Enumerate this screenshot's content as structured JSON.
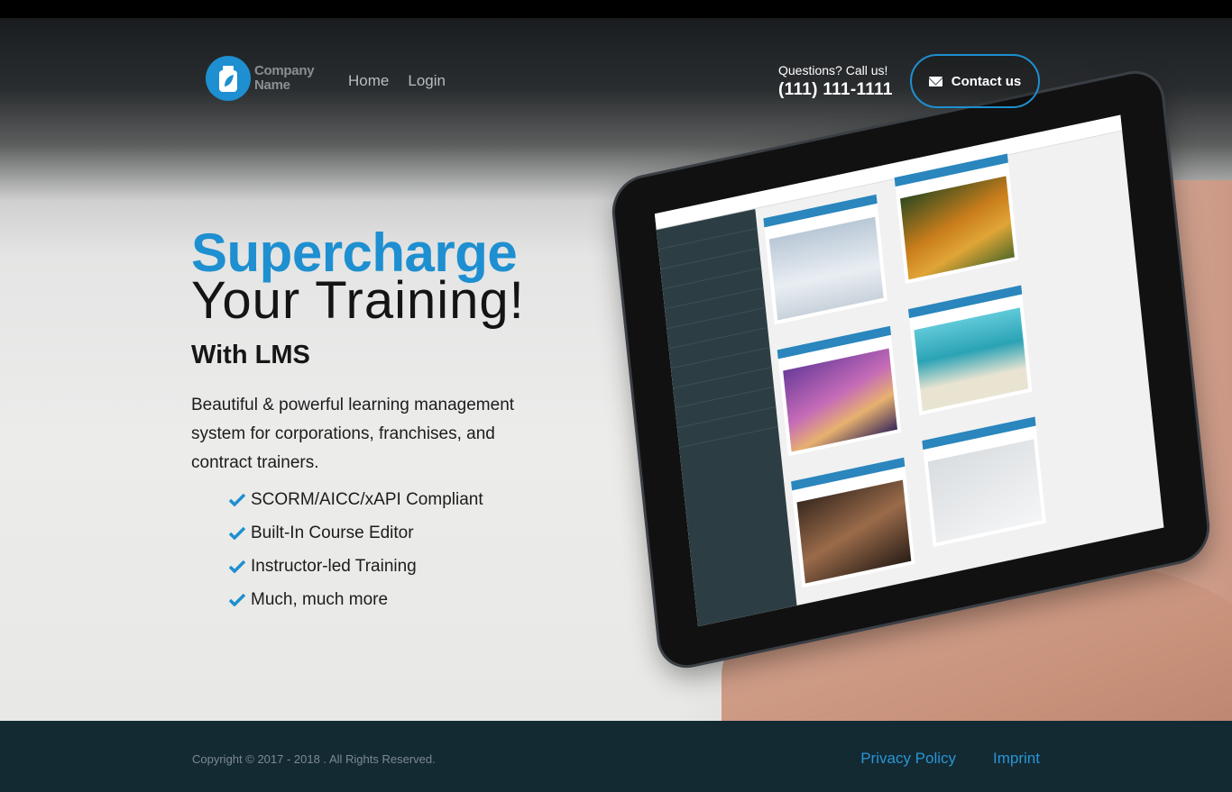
{
  "header": {
    "logo_line1": "Company",
    "logo_line2": "Name",
    "nav": [
      {
        "label": "Home"
      },
      {
        "label": "Login"
      }
    ],
    "call_label": "Questions? Call us!",
    "phone": "(111) 111-1111",
    "contact_label": "Contact us"
  },
  "hero": {
    "headline_accent": "Supercharge",
    "headline_rest": "Your Training!",
    "subhead": "With LMS",
    "description": "Beautiful & powerful learning management system for corporations, franchises, and contract trainers.",
    "features": [
      "SCORM/AICC/xAPI Compliant",
      "Built-In Course Editor",
      "Instructor-led Training",
      "Much, much more"
    ]
  },
  "footer": {
    "copyright": "Copyright © 2017 - 2018 . All Rights Reserved.",
    "links": [
      {
        "label": "Privacy Policy"
      },
      {
        "label": "Imprint"
      }
    ]
  },
  "colors": {
    "accent": "#1e8fd0",
    "footer_bg": "#132a33",
    "footer_link": "#2a95d4"
  },
  "icons": {
    "logo": "bottle-icon",
    "contact": "envelope-icon",
    "feature": "checkmark-icon"
  }
}
